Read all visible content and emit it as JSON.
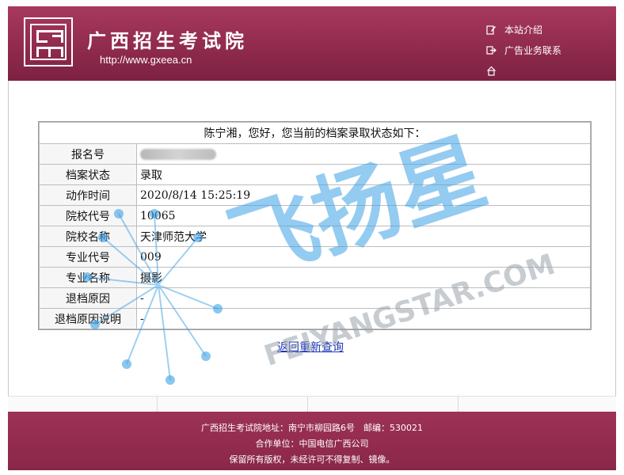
{
  "header": {
    "title": "广西招生考试院",
    "url": "http://www.gxeea.cn",
    "nav": [
      {
        "label": "本站介绍",
        "icon": "edit-icon"
      },
      {
        "label": "广告业务联系",
        "icon": "exit-icon"
      },
      {
        "label": "",
        "icon": "home-icon"
      }
    ]
  },
  "status": {
    "headline": "陈宁湘，您好，您当前的档案录取状态如下：",
    "rows": [
      {
        "label": "报名号",
        "value": ""
      },
      {
        "label": "档案状态",
        "value": "录取"
      },
      {
        "label": "动作时间",
        "value": "2020/8/14 15:25:19"
      },
      {
        "label": "院校代号",
        "value": "10065"
      },
      {
        "label": "院校名称",
        "value": "天津师范大学"
      },
      {
        "label": "专业代号",
        "value": "009"
      },
      {
        "label": "专业名称",
        "value": "摄影"
      },
      {
        "label": "退档原因",
        "value": "-"
      },
      {
        "label": "退档原因说明",
        "value": "-"
      }
    ],
    "back_link": "返回重新查询"
  },
  "footer": {
    "line1": "广西招生考试院地址：南宁市柳园路6号　邮编：530021",
    "line2": "合作单位：中国电信广西公司",
    "line3": "保留所有版权，未经许可不得复制、镜像。"
  },
  "watermark": {
    "text_cn": "飞扬星",
    "text_en": "FEIYANGSTAR.COM"
  },
  "colors": {
    "brand": "#8e2a4c",
    "link": "#1a33b8",
    "watermark": "#3ea2e6"
  }
}
